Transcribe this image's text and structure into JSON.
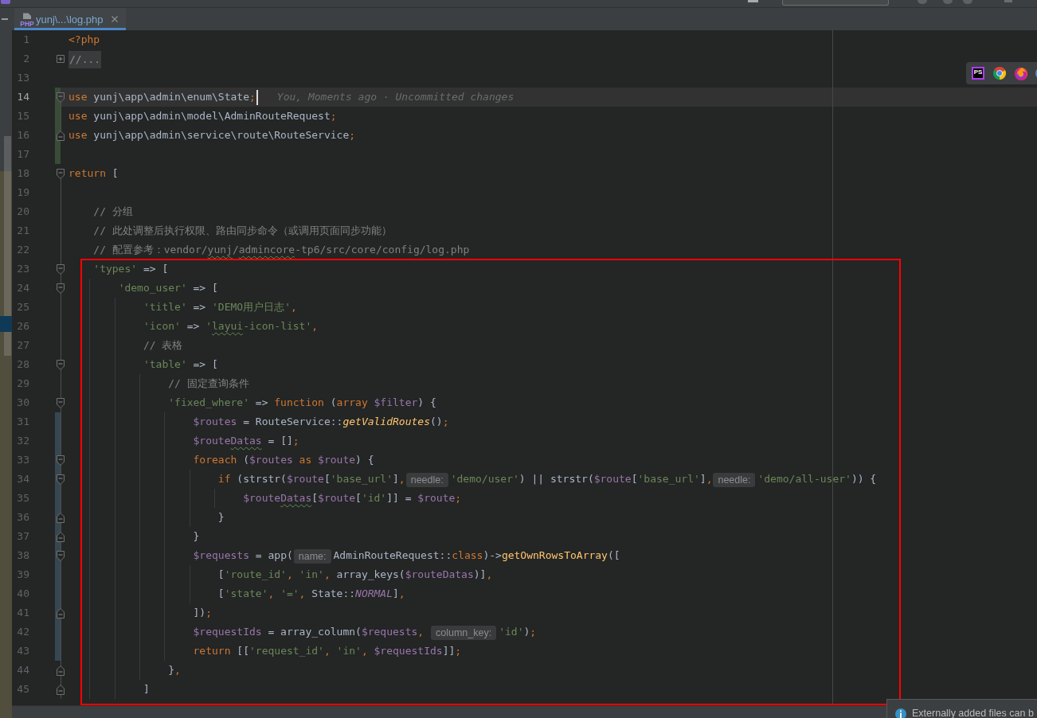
{
  "tabs": [
    {
      "label": "yunj\\...\\log.php",
      "file_icon_label": "PHP",
      "selected": true
    }
  ],
  "editor": {
    "lines": [
      {
        "number": "1",
        "current": false,
        "segments": [
          {
            "text": "<?php",
            "kind": "keyword"
          }
        ]
      },
      {
        "number": "2",
        "current": false,
        "fold": {
          "kind": "collapsed"
        },
        "segments": [
          {
            "text": "//...",
            "kind": "folded"
          }
        ]
      },
      {
        "number": "13",
        "current": false
      },
      {
        "number": "14",
        "current": true,
        "change": {
          "kind": "added"
        },
        "fold": {
          "kind": "start"
        },
        "segments": [
          {
            "text": "use",
            "kind": "keyword"
          },
          {
            "text": " yunj\\app\\admin\\enum\\State",
            "kind": "plain"
          },
          {
            "text": ";",
            "kind": "punct"
          },
          {
            "text": "You, Moments ago · Uncommitted changes",
            "kind": "blame"
          }
        ]
      },
      {
        "number": "15",
        "current": false,
        "change": {
          "kind": "added"
        },
        "segments": [
          {
            "text": "use",
            "kind": "keyword"
          },
          {
            "text": " yunj\\app\\admin\\model\\AdminRouteRequest",
            "kind": "plain"
          },
          {
            "text": ";",
            "kind": "punct"
          }
        ]
      },
      {
        "number": "16",
        "current": false,
        "change": {
          "kind": "added"
        },
        "fold": {
          "kind": "end"
        },
        "segments": [
          {
            "text": "use",
            "kind": "keyword"
          },
          {
            "text": " yunj\\app\\admin\\service\\route\\RouteService",
            "kind": "plain"
          },
          {
            "text": ";",
            "kind": "punct"
          }
        ]
      },
      {
        "number": "17",
        "current": false,
        "change": {
          "kind": "added"
        }
      },
      {
        "number": "18",
        "current": false,
        "fold": {
          "kind": "start"
        },
        "segments": [
          {
            "text": "return",
            "kind": "keyword"
          },
          {
            "text": " [",
            "kind": "plain"
          }
        ]
      },
      {
        "number": "19",
        "current": false
      },
      {
        "number": "20",
        "current": false,
        "segments": [
          {
            "text": "    // 分组",
            "kind": "comment"
          }
        ]
      },
      {
        "number": "21",
        "current": false,
        "segments": [
          {
            "text": "    // 此处调整后执行权限、路由同步命令（或调用页面同步功能）",
            "kind": "comment"
          }
        ]
      },
      {
        "number": "22",
        "current": false,
        "segments": [
          {
            "text": "    // 配置参考：vendor/",
            "kind": "comment"
          },
          {
            "text": "yunj",
            "kind": "comment",
            "misspelled": true
          },
          {
            "text": "/",
            "kind": "comment"
          },
          {
            "text": "admincore",
            "kind": "comment",
            "misspelled": true
          },
          {
            "text": "-tp6/src/core/config/log.php",
            "kind": "comment"
          }
        ]
      },
      {
        "number": "23",
        "current": false,
        "fold": {
          "kind": "start"
        },
        "segments": [
          {
            "text": "    'types'",
            "kind": "string"
          },
          {
            "text": " => [",
            "kind": "plain"
          }
        ]
      },
      {
        "number": "24",
        "current": false,
        "fold": {
          "kind": "start"
        },
        "segments": [
          {
            "text": "        'demo_user'",
            "kind": "string"
          },
          {
            "text": " => [",
            "kind": "plain"
          }
        ]
      },
      {
        "number": "25",
        "current": false,
        "segments": [
          {
            "text": "            'title'",
            "kind": "string"
          },
          {
            "text": " => ",
            "kind": "plain"
          },
          {
            "text": "'DEMO用户日志'",
            "kind": "string"
          },
          {
            "text": ",",
            "kind": "punct"
          }
        ]
      },
      {
        "number": "26",
        "current": false,
        "segments": [
          {
            "text": "            'icon'",
            "kind": "string"
          },
          {
            "text": " => ",
            "kind": "plain"
          },
          {
            "text": "'",
            "kind": "string"
          },
          {
            "text": "layui",
            "kind": "string",
            "misspelled": true
          },
          {
            "text": "-icon-list'",
            "kind": "string"
          },
          {
            "text": ",",
            "kind": "punct"
          }
        ]
      },
      {
        "number": "27",
        "current": false,
        "segments": [
          {
            "text": "            // 表格",
            "kind": "comment"
          }
        ]
      },
      {
        "number": "28",
        "current": false,
        "fold": {
          "kind": "start"
        },
        "segments": [
          {
            "text": "            'table'",
            "kind": "string"
          },
          {
            "text": " => [",
            "kind": "plain"
          }
        ]
      },
      {
        "number": "29",
        "current": false,
        "segments": [
          {
            "text": "                // 固定查询条件",
            "kind": "comment"
          }
        ]
      },
      {
        "number": "30",
        "current": false,
        "fold": {
          "kind": "start"
        },
        "segments": [
          {
            "text": "                'fixed_where'",
            "kind": "string"
          },
          {
            "text": " => ",
            "kind": "plain"
          },
          {
            "text": "function",
            "kind": "keyword"
          },
          {
            "text": " (",
            "kind": "plain"
          },
          {
            "text": "array",
            "kind": "keyword"
          },
          {
            "text": " $filter",
            "kind": "variable"
          },
          {
            "text": ") {",
            "kind": "plain"
          }
        ]
      },
      {
        "number": "31",
        "current": false,
        "change": {
          "kind": "modified"
        },
        "segments": [
          {
            "text": "                    $routes",
            "kind": "variable"
          },
          {
            "text": " = RouteService::",
            "kind": "plain"
          },
          {
            "text": "getValidRoutes",
            "kind": "static"
          },
          {
            "text": "()",
            "kind": "plain"
          },
          {
            "text": ";",
            "kind": "punct"
          }
        ]
      },
      {
        "number": "32",
        "current": false,
        "change": {
          "kind": "modified"
        },
        "segments": [
          {
            "text": "                    $route",
            "kind": "variable"
          },
          {
            "text": "Datas",
            "kind": "variable",
            "misspelled": true
          },
          {
            "text": " = []",
            "kind": "plain"
          },
          {
            "text": ";",
            "kind": "punct"
          }
        ]
      },
      {
        "number": "33",
        "current": false,
        "change": {
          "kind": "modified"
        },
        "fold": {
          "kind": "start"
        },
        "segments": [
          {
            "text": "                    foreach",
            "kind": "keyword"
          },
          {
            "text": " (",
            "kind": "plain"
          },
          {
            "text": "$routes",
            "kind": "variable"
          },
          {
            "text": " as ",
            "kind": "keyword"
          },
          {
            "text": "$route",
            "kind": "variable"
          },
          {
            "text": ") {",
            "kind": "plain"
          }
        ]
      },
      {
        "number": "34",
        "current": false,
        "change": {
          "kind": "modified"
        },
        "fold": {
          "kind": "start"
        },
        "segments": [
          {
            "text": "                        if",
            "kind": "keyword"
          },
          {
            "text": " (strstr(",
            "kind": "plain"
          },
          {
            "text": "$route",
            "kind": "variable"
          },
          {
            "text": "[",
            "kind": "plain"
          },
          {
            "text": "'base_url'",
            "kind": "string"
          },
          {
            "text": "]",
            "kind": "plain"
          },
          {
            "text": ",",
            "kind": "punct"
          },
          {
            "text": "needle:",
            "kind": "hint"
          },
          {
            "text": "'demo/user'",
            "kind": "string"
          },
          {
            "text": ") || strstr(",
            "kind": "plain"
          },
          {
            "text": "$route",
            "kind": "variable"
          },
          {
            "text": "[",
            "kind": "plain"
          },
          {
            "text": "'base_url'",
            "kind": "string"
          },
          {
            "text": "]",
            "kind": "plain"
          },
          {
            "text": ",",
            "kind": "punct"
          },
          {
            "text": "needle:",
            "kind": "hint"
          },
          {
            "text": "'demo/all-user'",
            "kind": "string"
          },
          {
            "text": ")) {",
            "kind": "plain"
          }
        ]
      },
      {
        "number": "35",
        "current": false,
        "change": {
          "kind": "modified"
        },
        "segments": [
          {
            "text": "                            $route",
            "kind": "variable"
          },
          {
            "text": "Datas",
            "kind": "variable",
            "misspelled": true
          },
          {
            "text": "[",
            "kind": "plain"
          },
          {
            "text": "$route",
            "kind": "variable"
          },
          {
            "text": "[",
            "kind": "plain"
          },
          {
            "text": "'id'",
            "kind": "string"
          },
          {
            "text": "]] = ",
            "kind": "plain"
          },
          {
            "text": "$route",
            "kind": "variable"
          },
          {
            "text": ";",
            "kind": "punct"
          }
        ]
      },
      {
        "number": "36",
        "current": false,
        "change": {
          "kind": "modified"
        },
        "fold": {
          "kind": "end"
        },
        "segments": [
          {
            "text": "                        }",
            "kind": "plain"
          }
        ]
      },
      {
        "number": "37",
        "current": false,
        "change": {
          "kind": "modified"
        },
        "fold": {
          "kind": "end"
        },
        "segments": [
          {
            "text": "                    }",
            "kind": "plain"
          }
        ]
      },
      {
        "number": "38",
        "current": false,
        "change": {
          "kind": "modified"
        },
        "fold": {
          "kind": "start"
        },
        "segments": [
          {
            "text": "                    $requests",
            "kind": "variable"
          },
          {
            "text": " = app(",
            "kind": "plain"
          },
          {
            "text": "name:",
            "kind": "hint"
          },
          {
            "text": "AdminRouteRequest::",
            "kind": "plain"
          },
          {
            "text": "class",
            "kind": "keyword"
          },
          {
            "text": ")->",
            "kind": "plain"
          },
          {
            "text": "getOwnRowsToArray",
            "kind": "method"
          },
          {
            "text": "([",
            "kind": "plain"
          }
        ]
      },
      {
        "number": "39",
        "current": false,
        "change": {
          "kind": "modified"
        },
        "segments": [
          {
            "text": "                        [",
            "kind": "plain"
          },
          {
            "text": "'route_id'",
            "kind": "string"
          },
          {
            "text": ", ",
            "kind": "punct"
          },
          {
            "text": "'in'",
            "kind": "string"
          },
          {
            "text": ", ",
            "kind": "punct"
          },
          {
            "text": "array_keys(",
            "kind": "plain"
          },
          {
            "text": "$routeDatas",
            "kind": "variable"
          },
          {
            "text": ")]",
            "kind": "plain"
          },
          {
            "text": ",",
            "kind": "punct"
          }
        ]
      },
      {
        "number": "40",
        "current": false,
        "change": {
          "kind": "modified"
        },
        "segments": [
          {
            "text": "                        [",
            "kind": "plain"
          },
          {
            "text": "'state'",
            "kind": "string"
          },
          {
            "text": ", ",
            "kind": "punct"
          },
          {
            "text": "'='",
            "kind": "string"
          },
          {
            "text": ", ",
            "kind": "punct"
          },
          {
            "text": "State::",
            "kind": "plain"
          },
          {
            "text": "NORMAL",
            "kind": "constant"
          },
          {
            "text": "]",
            "kind": "plain"
          },
          {
            "text": ",",
            "kind": "punct"
          }
        ]
      },
      {
        "number": "41",
        "current": false,
        "change": {
          "kind": "modified"
        },
        "fold": {
          "kind": "end"
        },
        "segments": [
          {
            "text": "                    ])",
            "kind": "plain"
          },
          {
            "text": ";",
            "kind": "punct"
          }
        ]
      },
      {
        "number": "42",
        "current": false,
        "change": {
          "kind": "modified"
        },
        "segments": [
          {
            "text": "                    $requestIds",
            "kind": "variable"
          },
          {
            "text": " = array_column(",
            "kind": "plain"
          },
          {
            "text": "$requests",
            "kind": "variable"
          },
          {
            "text": ", ",
            "kind": "punct"
          },
          {
            "text": "column_key:",
            "kind": "hint"
          },
          {
            "text": "'id'",
            "kind": "string"
          },
          {
            "text": ")",
            "kind": "plain"
          },
          {
            "text": ";",
            "kind": "punct"
          }
        ]
      },
      {
        "number": "43",
        "current": false,
        "change": {
          "kind": "modified"
        },
        "segments": [
          {
            "text": "                    return",
            "kind": "keyword"
          },
          {
            "text": " [[",
            "kind": "plain"
          },
          {
            "text": "'request_id'",
            "kind": "string"
          },
          {
            "text": ", ",
            "kind": "punct"
          },
          {
            "text": "'in'",
            "kind": "string"
          },
          {
            "text": ", ",
            "kind": "punct"
          },
          {
            "text": "$requestIds",
            "kind": "variable"
          },
          {
            "text": "]]",
            "kind": "plain"
          },
          {
            "text": ";",
            "kind": "punct"
          }
        ]
      },
      {
        "number": "44",
        "current": false,
        "fold": {
          "kind": "end"
        },
        "segments": [
          {
            "text": "                }",
            "kind": "plain"
          },
          {
            "text": ",",
            "kind": "punct"
          }
        ]
      },
      {
        "number": "45",
        "current": false,
        "fold": {
          "kind": "end"
        },
        "segments": [
          {
            "text": "            ]",
            "kind": "plain"
          }
        ]
      }
    ]
  },
  "browser_popup": {
    "logo_label": "PS"
  },
  "notification": {
    "text": "Externally added files can b"
  }
}
